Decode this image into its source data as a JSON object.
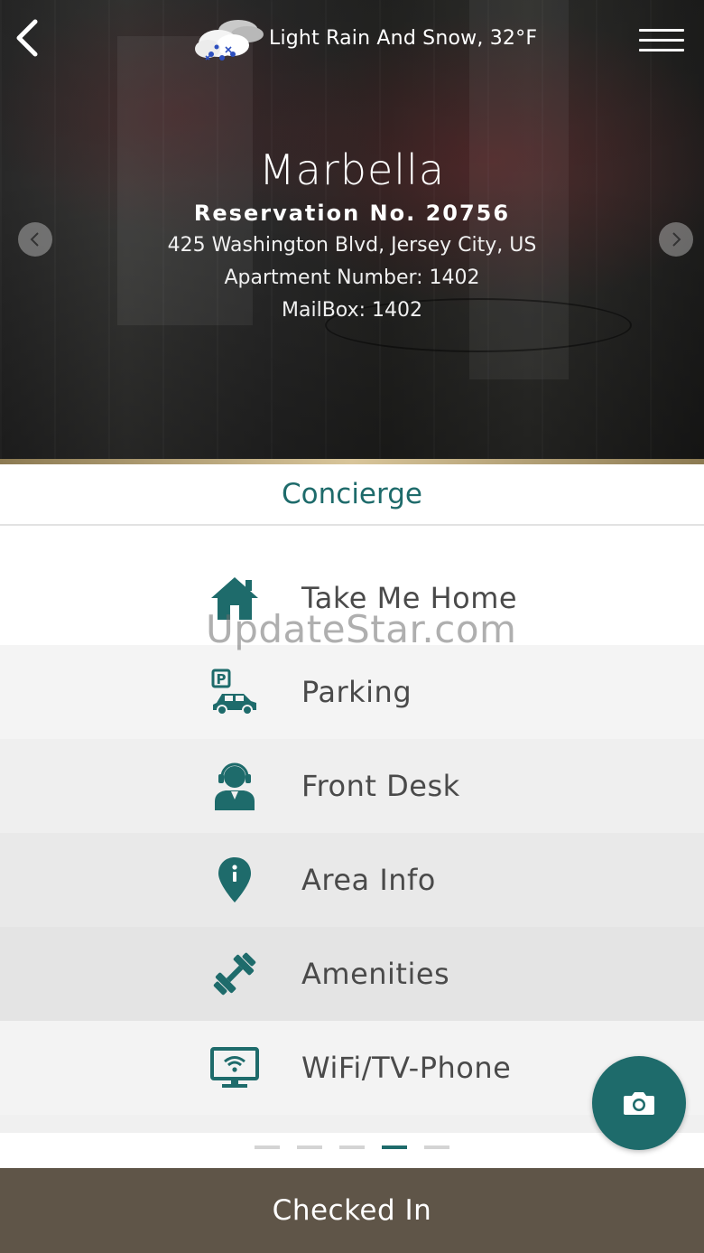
{
  "header": {
    "weather_text": "Light Rain And Snow, 32°F",
    "back_icon": "chevron-left-icon",
    "weather_icon": "rain-snow-cloud-icon",
    "menu_icon": "hamburger-menu-icon"
  },
  "property": {
    "name": "Marbella",
    "reservation": "Reservation No. 20756",
    "address": "425 Washington Blvd, Jersey City, US",
    "apartment": "Apartment Number: 1402",
    "mailbox": "MailBox: 1402"
  },
  "section": {
    "title": "Concierge"
  },
  "menu": {
    "items": [
      {
        "label": "Take Me Home",
        "icon": "home-icon"
      },
      {
        "label": "Parking",
        "icon": "parking-car-icon"
      },
      {
        "label": "Front Desk",
        "icon": "receptionist-icon"
      },
      {
        "label": "Area Info",
        "icon": "map-pin-info-icon"
      },
      {
        "label": "Amenities",
        "icon": "dumbbell-icon"
      },
      {
        "label": "WiFi/TV-Phone",
        "icon": "wifi-tv-icon"
      }
    ]
  },
  "watermark": "UpdateStar.com",
  "pager": {
    "count": 5,
    "active_index": 3
  },
  "fab": {
    "icon": "camera-icon"
  },
  "footer": {
    "status": "Checked In"
  },
  "colors": {
    "accent": "#1e6b6b",
    "footer_bg": "#5f5548",
    "gold_rule": "#d8c59a"
  }
}
